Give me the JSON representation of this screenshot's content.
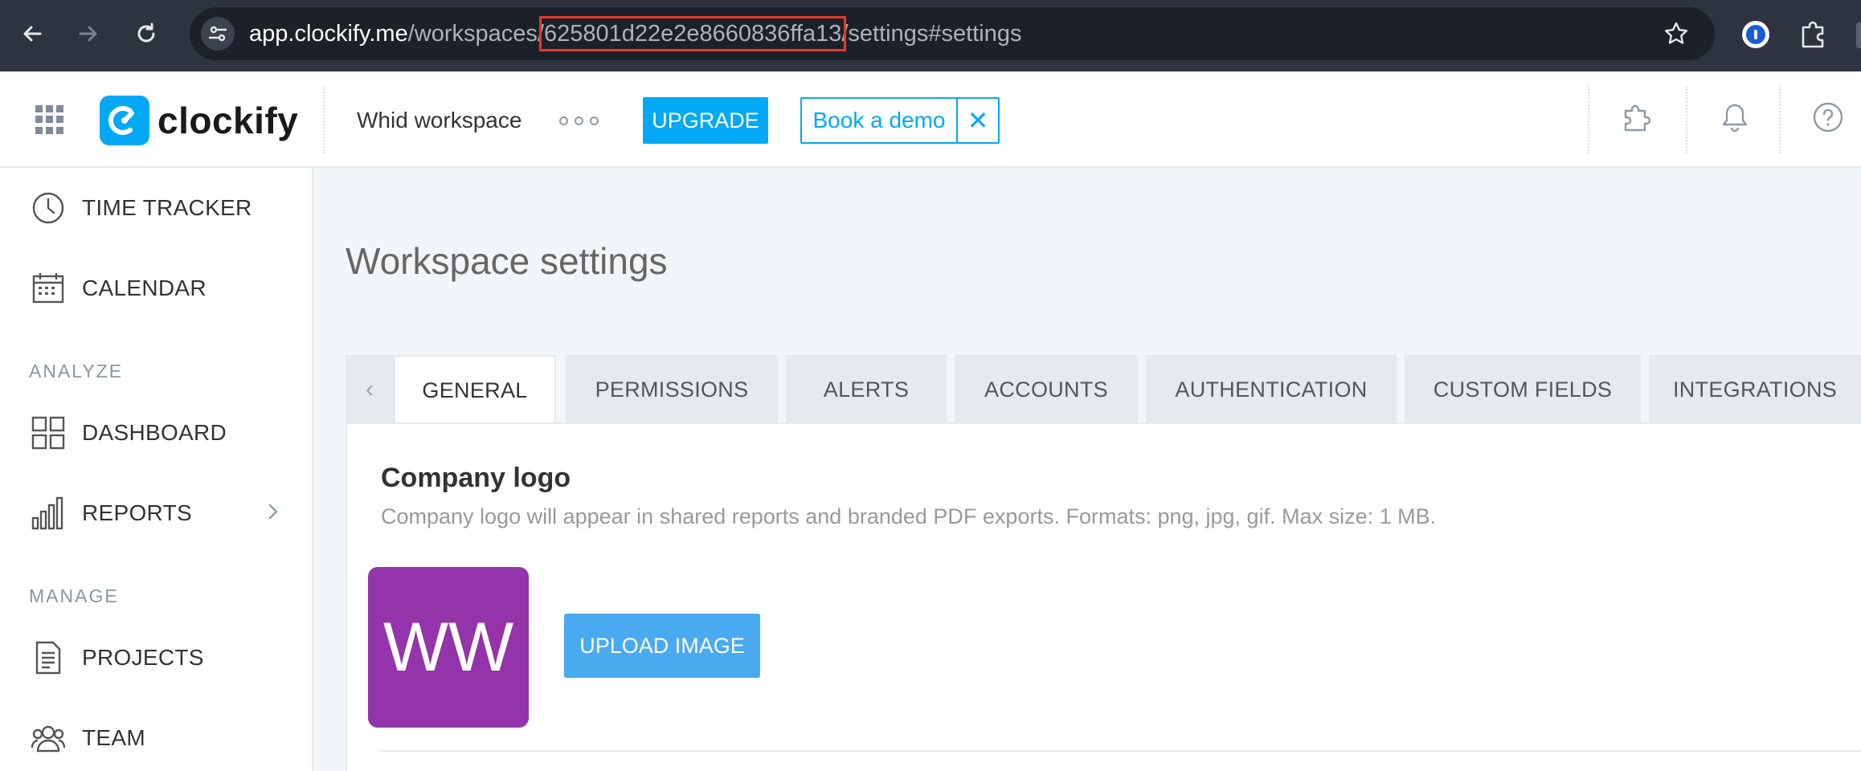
{
  "browser": {
    "url_host": "app.clockify.me",
    "url_path_start": "/workspaces/",
    "url_highlight": "625801d22e2e8660836ffa13",
    "url_path_end": "/settings#settings"
  },
  "header": {
    "logo_text": "clockify",
    "workspace_name": "Whid workspace",
    "upgrade_label": "UPGRADE",
    "demo_label": "Book a demo",
    "demo_close": "✕"
  },
  "sidebar": {
    "items": [
      {
        "label": "TIME TRACKER",
        "icon": "clock-icon"
      },
      {
        "label": "CALENDAR",
        "icon": "calendar-icon"
      },
      {
        "label": "DASHBOARD",
        "icon": "dashboard-icon"
      },
      {
        "label": "REPORTS",
        "icon": "reports-icon"
      },
      {
        "label": "PROJECTS",
        "icon": "projects-icon"
      },
      {
        "label": "TEAM",
        "icon": "team-icon"
      }
    ],
    "sections": {
      "analyze": "ANALYZE",
      "manage": "MANAGE"
    }
  },
  "main": {
    "title": "Workspace settings",
    "tabs": [
      {
        "label": "GENERAL",
        "active": true
      },
      {
        "label": "PERMISSIONS"
      },
      {
        "label": "ALERTS"
      },
      {
        "label": "ACCOUNTS"
      },
      {
        "label": "AUTHENTICATION"
      },
      {
        "label": "CUSTOM FIELDS"
      },
      {
        "label": "INTEGRATIONS"
      }
    ],
    "tab_prev": "‹",
    "company_logo": {
      "title": "Company logo",
      "description": "Company logo will appear in shared reports and branded PDF exports. Formats: png, jpg, gif. Max size: 1 MB.",
      "initials": "WW",
      "upload_label": "UPLOAD IMAGE"
    }
  },
  "colors": {
    "accent": "#03a9f4",
    "workspace_logo_bg": "#9334aa",
    "url_highlight_border": "#e23a26"
  }
}
